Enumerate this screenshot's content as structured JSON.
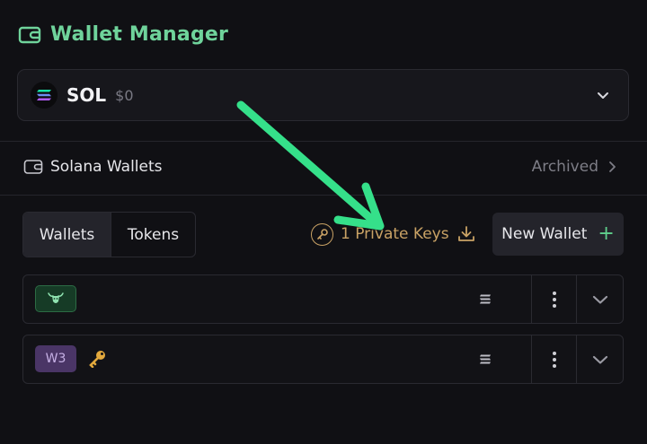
{
  "header": {
    "title": "Wallet Manager",
    "icon": "wallet-icon",
    "accent": "#6fd39b"
  },
  "token_selector": {
    "symbol": "SOL",
    "balance": "$0",
    "icon": "solana-logo-icon"
  },
  "section": {
    "label": "Solana Wallets",
    "archived_label": "Archived"
  },
  "tabs": [
    {
      "label": "Wallets",
      "active": true
    },
    {
      "label": "Tokens",
      "active": false
    }
  ],
  "private_keys": {
    "label": "1 Private Keys",
    "color": "#c9a265"
  },
  "new_wallet": {
    "label": "New Wallet",
    "plus": "+"
  },
  "wallets": [
    {
      "badge": "",
      "badge_icon": "bull-icon",
      "has_key": false
    },
    {
      "badge": "W3",
      "badge_icon": "",
      "has_key": true
    }
  ],
  "annotation": {
    "color": "#35e08a",
    "points_to": "private-keys-button"
  }
}
